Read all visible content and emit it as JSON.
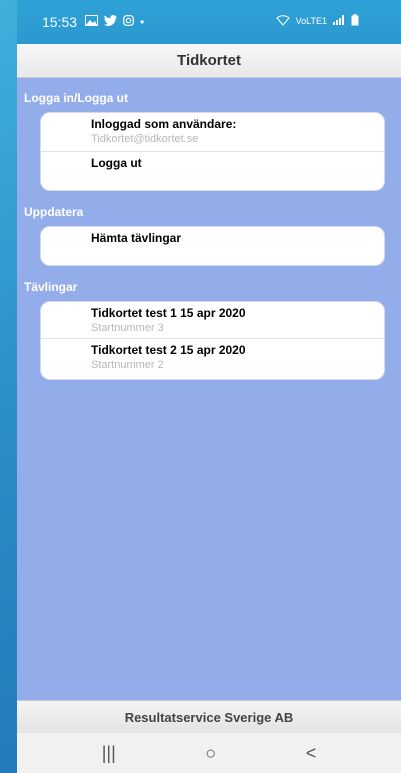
{
  "status": {
    "time": "15:53",
    "icons": [
      "gallery-icon",
      "twitter-icon",
      "instagram-icon",
      "dot-icon"
    ],
    "right_icons": [
      "wifi-icon",
      "volte-icon",
      "signal-icon",
      "battery-icon"
    ],
    "volte_text": "VoLTE1"
  },
  "header": {
    "title": "Tidkortet"
  },
  "sections": {
    "login": {
      "title": "Logga in/Logga ut",
      "items": [
        {
          "main": "Inloggad som användare:",
          "sub": "Tidkortet@tidkortet.se"
        },
        {
          "main": "Logga ut",
          "sub": ""
        }
      ]
    },
    "update": {
      "title": "Uppdatera",
      "items": [
        {
          "main": "Hämta tävlingar",
          "sub": ""
        }
      ]
    },
    "competitions": {
      "title": "Tävlingar",
      "items": [
        {
          "main": "Tidkortet test 1 15 apr 2020",
          "sub": "Startnummer 3"
        },
        {
          "main": "Tidkortet test 2 15 apr 2020",
          "sub": "Startnummer 2"
        }
      ]
    }
  },
  "footer": {
    "text": "Resultatservice Sverige AB"
  },
  "navbar": {
    "recent": "|||",
    "home": "○",
    "back": "<"
  }
}
